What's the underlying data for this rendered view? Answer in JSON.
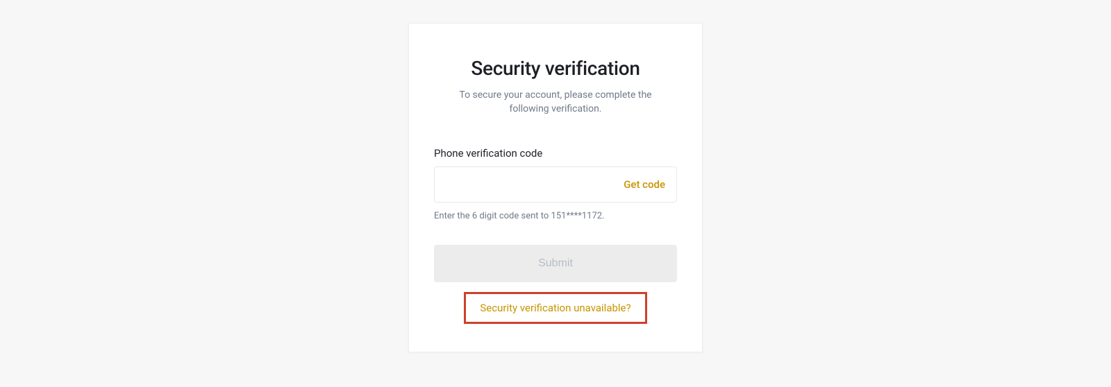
{
  "header": {
    "title": "Security verification",
    "subtitle": "To secure your account, please complete the following verification."
  },
  "form": {
    "field_label": "Phone verification code",
    "code_value": "",
    "get_code_label": "Get code",
    "helper_text": "Enter the 6 digit code sent to 151****1172.",
    "submit_label": "Submit",
    "unavailable_label": "Security verification unavailable?"
  },
  "colors": {
    "accent": "#c99400",
    "highlight_border": "#cd412b",
    "text_primary": "#1e2026",
    "text_secondary": "#707a8a",
    "disabled_bg": "#ececec",
    "disabled_text": "#b7bdc6"
  }
}
